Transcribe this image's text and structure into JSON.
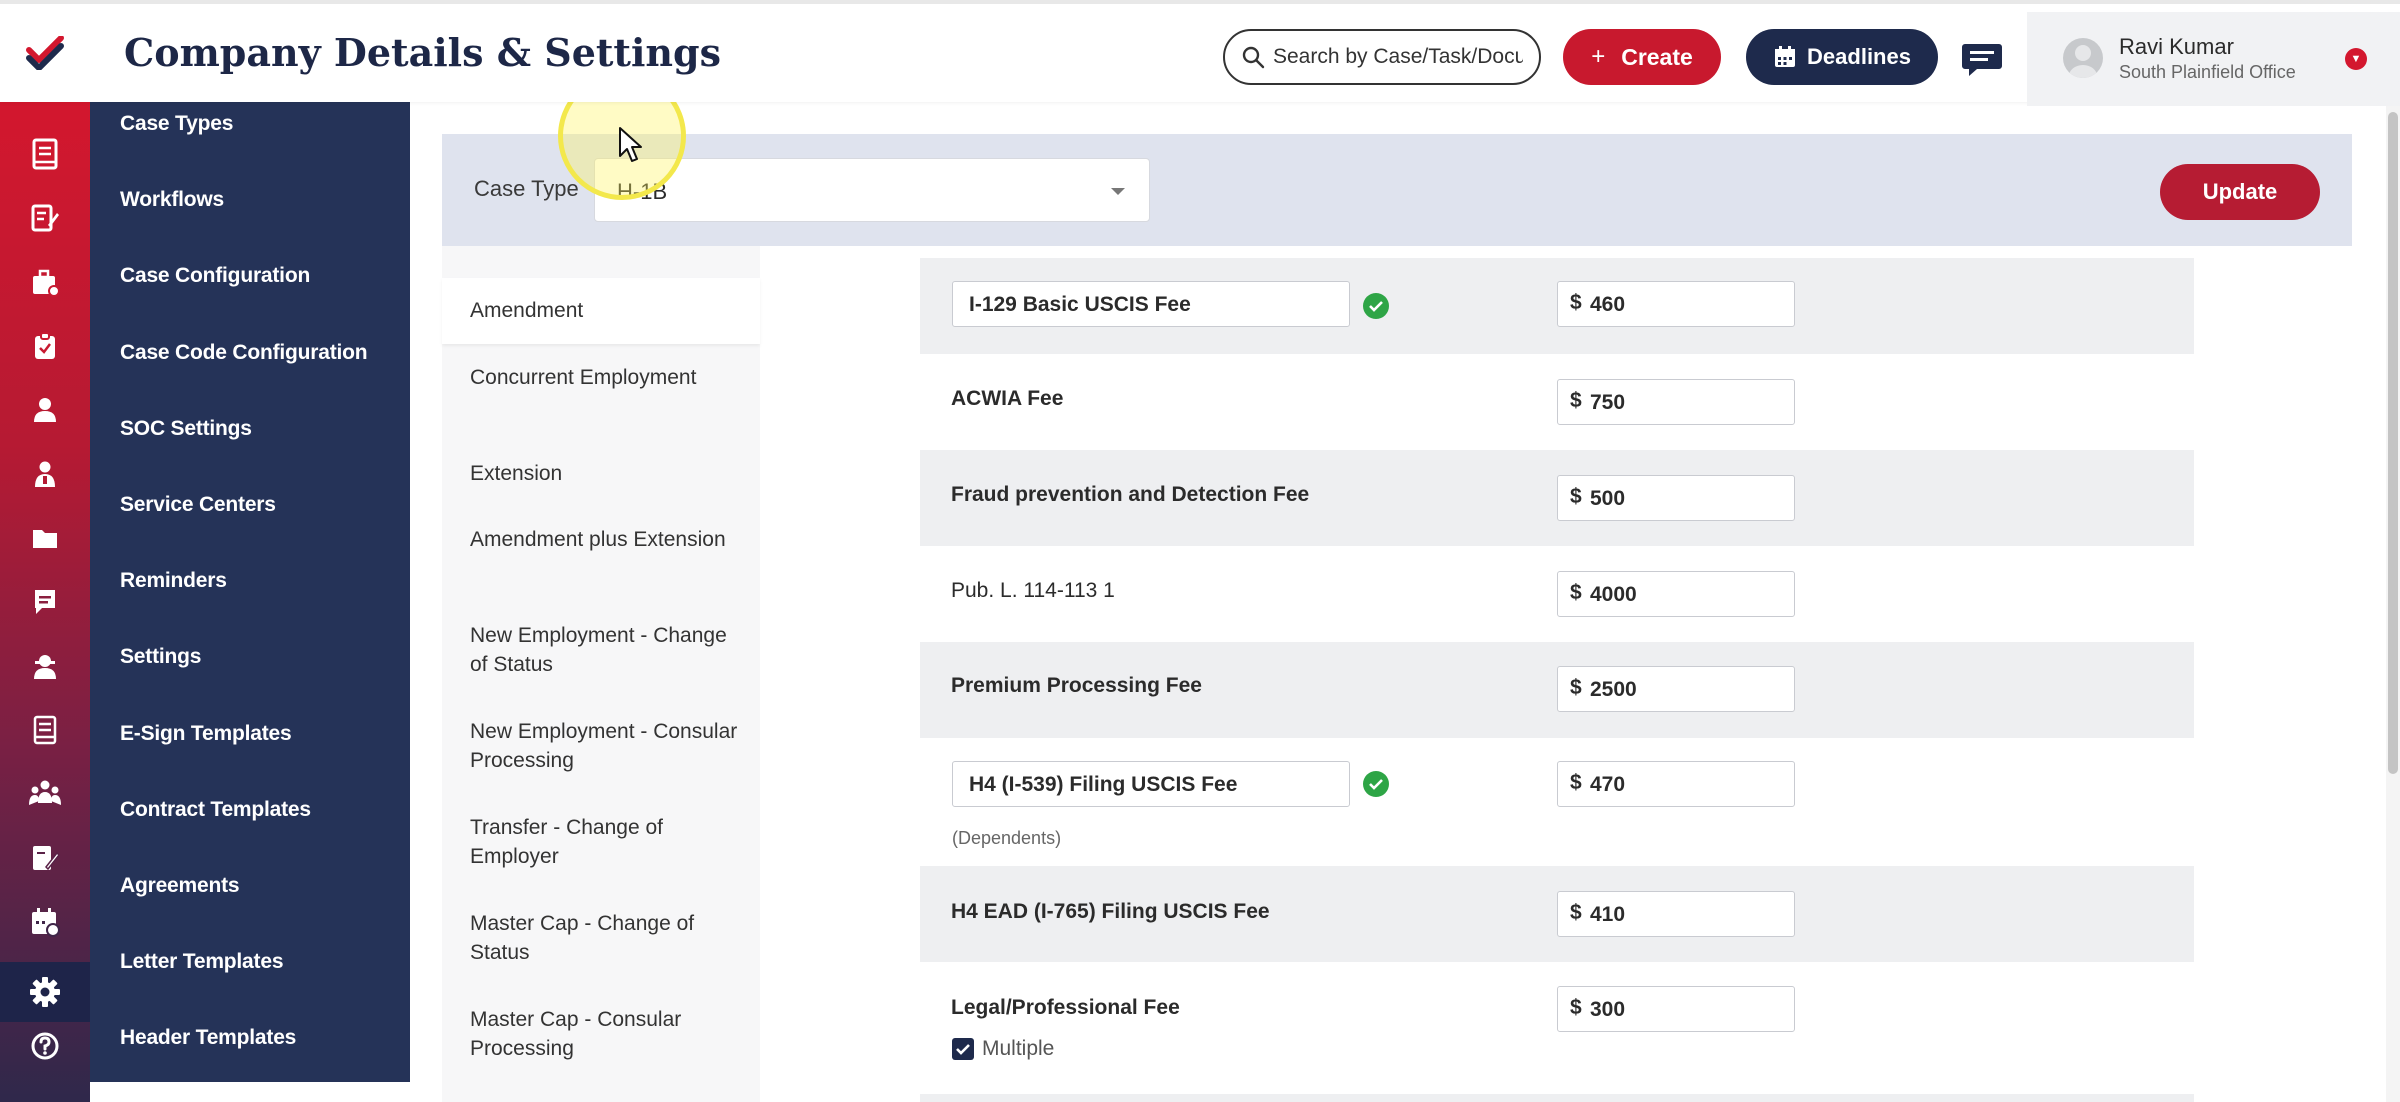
{
  "header": {
    "title": "Company Details & Settings",
    "search_placeholder": "Search by Case/Task/Document",
    "create_label": "Create",
    "deadlines_label": "Deadlines",
    "user_name": "Ravi Kumar",
    "user_office": "South Plainfield Office"
  },
  "rail": {
    "icons": [
      "book-icon",
      "edit-doc-icon",
      "briefcase-icon",
      "clipboard-icon",
      "user-icon",
      "person-icon",
      "folder-icon",
      "message-icon",
      "user-badge-icon",
      "ledger-icon",
      "team-icon",
      "signature-icon",
      "calendar-icon",
      "settings-gear-icon",
      "help-icon"
    ],
    "active": "settings-gear-icon"
  },
  "sidebar": {
    "items": [
      {
        "label": "Case Types"
      },
      {
        "label": "Workflows"
      },
      {
        "label": "Case Configuration"
      },
      {
        "label": "Case Code Configuration"
      },
      {
        "label": "SOC Settings"
      },
      {
        "label": "Service Centers"
      },
      {
        "label": "Reminders"
      },
      {
        "label": "Settings"
      },
      {
        "label": "E-Sign Templates"
      },
      {
        "label": "Contract Templates"
      },
      {
        "label": "Agreements"
      },
      {
        "label": "Letter Templates"
      },
      {
        "label": "Header Templates"
      }
    ]
  },
  "toolbar": {
    "case_type_label": "Case Type",
    "case_type_value": "H-1B",
    "update_label": "Update"
  },
  "subnav": {
    "items": [
      {
        "label": "Amendment"
      },
      {
        "label": "Concurrent Employment"
      },
      {
        "label": "Extension"
      },
      {
        "label": "Amendment plus Extension"
      },
      {
        "label": "New Employment - Change of Status"
      },
      {
        "label": "New Employment - Consular Processing"
      },
      {
        "label": "Transfer - Change of Employer"
      },
      {
        "label": "Master Cap - Change of Status"
      },
      {
        "label": "Master Cap - Consular Processing"
      }
    ],
    "active": "Amendment"
  },
  "fees": {
    "currency": "$",
    "rows": [
      {
        "name": "I-129 Basic USCIS Fee",
        "amount": "460"
      },
      {
        "name": "ACWIA Fee",
        "amount": "750"
      },
      {
        "name": "Fraud prevention and Detection Fee",
        "amount": "500"
      },
      {
        "name": "Pub. L. 114-113 1",
        "amount": "4000"
      },
      {
        "name": "Premium Processing Fee",
        "amount": "2500"
      },
      {
        "name": "H4 (I-539) Filing USCIS Fee",
        "amount": "470",
        "note": "(Dependents)"
      },
      {
        "name": "H4 EAD (I-765) Filing USCIS Fee",
        "amount": "410"
      },
      {
        "name": "Legal/Professional Fee",
        "amount": "300",
        "checkbox_label": "Multiple"
      }
    ]
  }
}
